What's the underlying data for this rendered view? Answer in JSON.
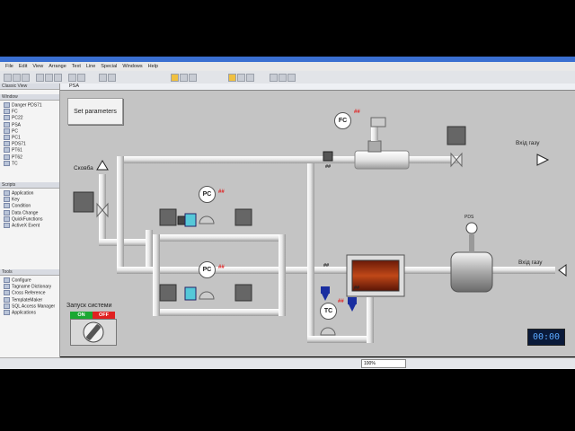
{
  "menu": [
    "File",
    "Edit",
    "View",
    "Arrange",
    "Text",
    "Line",
    "Special",
    "Windows",
    "Help"
  ],
  "sidebar": {
    "classic_view_label": "Classic View",
    "window_header": "Window",
    "windows": [
      "Danger PDS71",
      "FC",
      "PC22",
      "PSA",
      "PC",
      "PC1",
      "PDS71",
      "PT61",
      "PT62",
      "TC"
    ],
    "scripts_header": "Scripts",
    "scripts": [
      "Application",
      "Key",
      "Condition",
      "Data Change",
      "QuickFunctions",
      "ActiveX Event"
    ],
    "tools_header": "Tools",
    "tools": [
      "Configure",
      "Tagname Dictionary",
      "Cross Reference",
      "TemplateMaker",
      "SQL Access Manager",
      "Applications"
    ]
  },
  "window": {
    "title": "PSA"
  },
  "hmi": {
    "set_parameters": "Set parameters",
    "inlet_label": "Сковба",
    "outlet_top": "Вхід газу",
    "outlet_right": "Вхід газу",
    "flow_controller": "FC",
    "pressure_controller": "PC",
    "temp_controller": "TC",
    "pds_label": "PDS",
    "tag_red": "##",
    "tag_black": "##",
    "start_system": "Запуск системи",
    "on": "ON",
    "off": "OFF",
    "clock": "00:00"
  },
  "colors": {
    "pipe": "#e8e8e8",
    "accent_blue": "#1a2ea0",
    "on_green": "#1aa832",
    "off_red": "#e02020"
  },
  "statusbar": {
    "zoom_value": "100%"
  }
}
